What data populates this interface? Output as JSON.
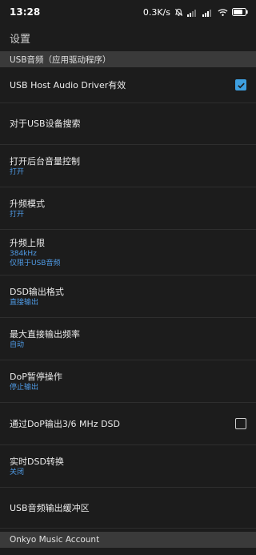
{
  "status": {
    "time": "13:28",
    "speed": "0.3K/s",
    "battery_color": "#ffffff"
  },
  "toolbar": {
    "title": "设置"
  },
  "section_usb": {
    "label": "USB音频（应用驱动程序）"
  },
  "prefs": {
    "usb_host_driver": {
      "title": "USB Host Audio Driver有效",
      "checked": true
    },
    "usb_device_search": {
      "title": "对于USB设备搜索"
    },
    "background_volume": {
      "title": "打开后台音量控制",
      "summary": "打开"
    },
    "upsampling_mode": {
      "title": "升频模式",
      "summary": "打开"
    },
    "upsampling_limit": {
      "title": "升频上限",
      "summary": "384kHz",
      "summary2": "仅限于USB音频"
    },
    "dsd_output_format": {
      "title": "DSD输出格式",
      "summary": "直接输出"
    },
    "max_direct_output": {
      "title": "最大直接输出频率",
      "summary": "自动"
    },
    "dop_pause": {
      "title": "DoP暂停操作",
      "summary": "停止输出"
    },
    "dop_dsd_output": {
      "title": "通过DoP输出3/6 MHz DSD",
      "checked": false
    },
    "realtime_dsd": {
      "title": "实时DSD转换",
      "summary": "关闭"
    },
    "usb_buffer": {
      "title": "USB音频输出缓冲区"
    }
  },
  "section_onkyo": {
    "label": "Onkyo Music Account"
  },
  "colors": {
    "accent": "#3e9fe0",
    "summary": "#4f9be6",
    "background": "#1c1c1c",
    "header": "#3a3a3a"
  }
}
